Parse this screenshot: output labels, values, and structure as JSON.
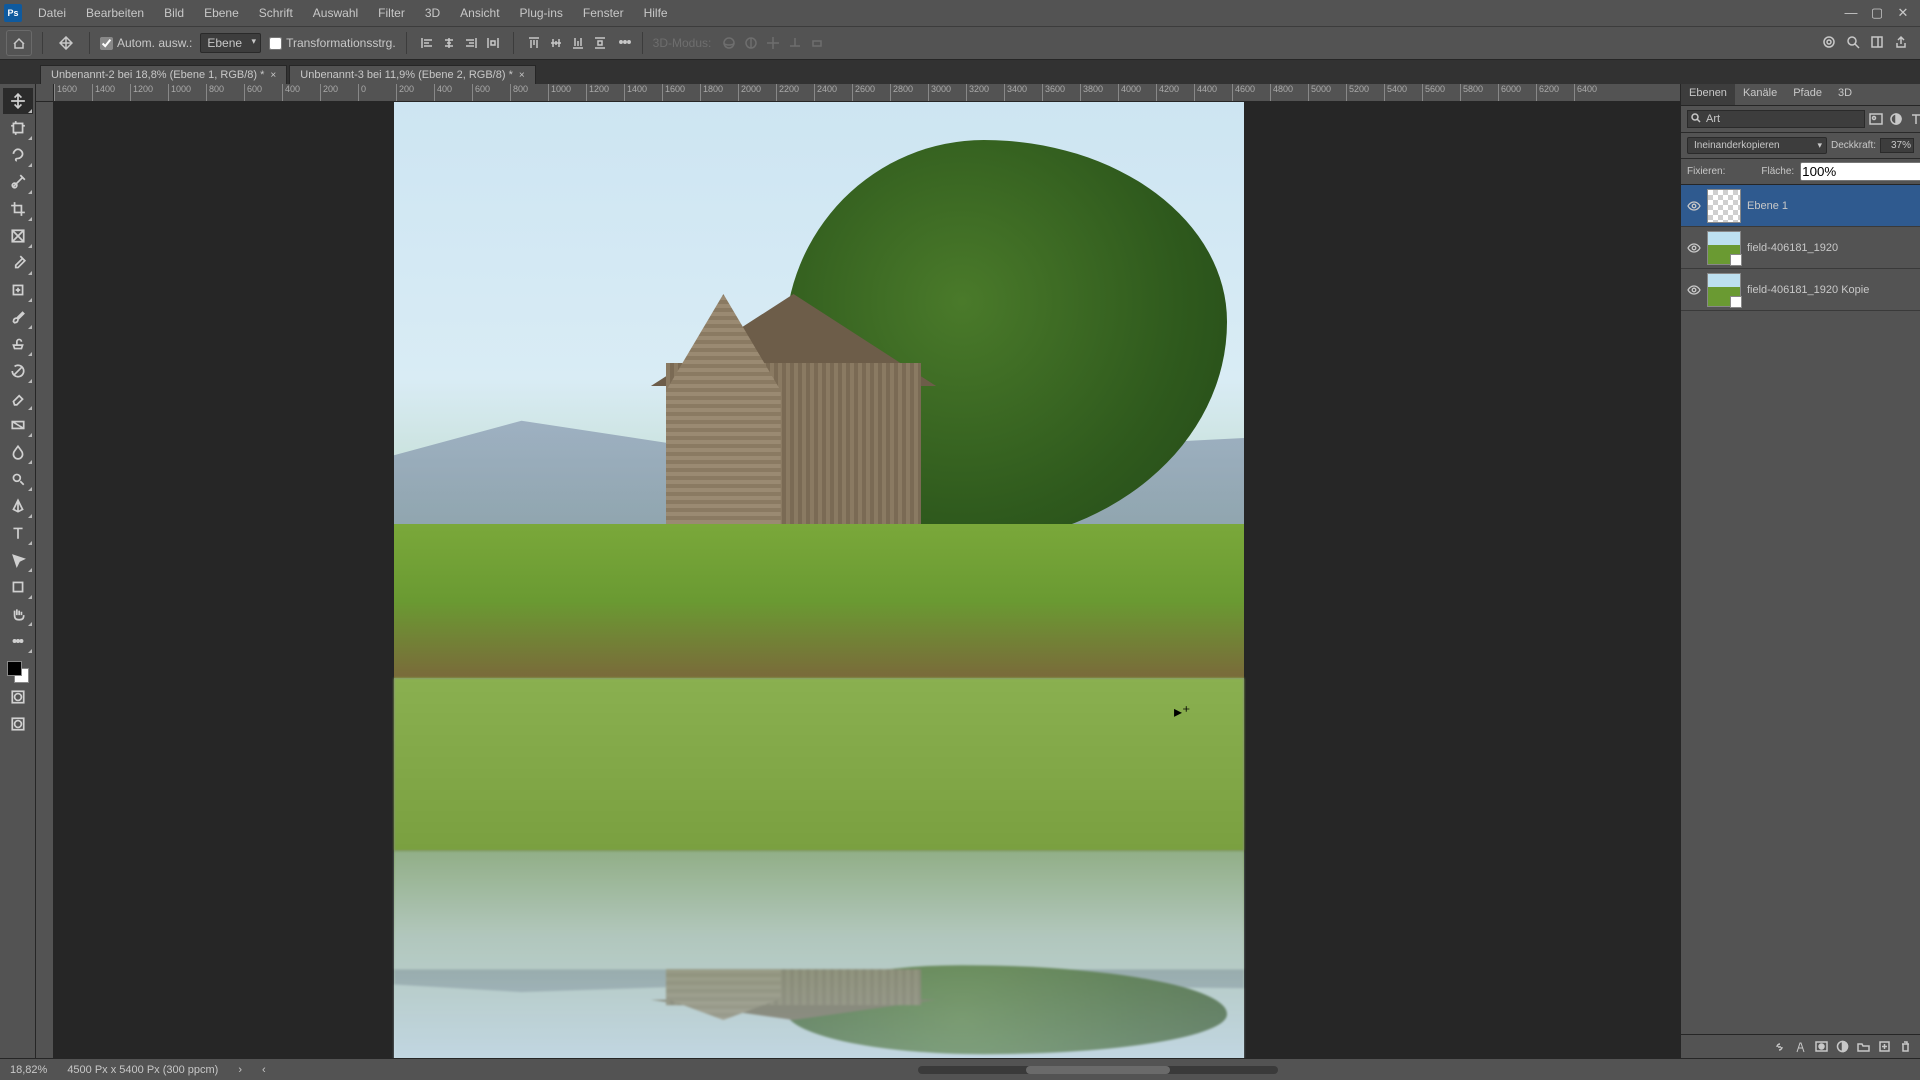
{
  "menu": {
    "items": [
      "Datei",
      "Bearbeiten",
      "Bild",
      "Ebene",
      "Schrift",
      "Auswahl",
      "Filter",
      "3D",
      "Ansicht",
      "Plug-ins",
      "Fenster",
      "Hilfe"
    ]
  },
  "options": {
    "auto_select": "Autom. ausw.:",
    "layer_dd": "Ebene",
    "transform_controls": "Transformationsstrg.",
    "mode3d": "3D-Modus:"
  },
  "tabs": [
    {
      "title": "Unbenannt-2 bei 18,8% (Ebene 1, RGB/8) *"
    },
    {
      "title": "Unbenannt-3 bei 11,9% (Ebene 2, RGB/8) *"
    }
  ],
  "ruler_marks": [
    "1600",
    "1400",
    "1200",
    "1000",
    "800",
    "600",
    "400",
    "200",
    "0",
    "200",
    "400",
    "600",
    "800",
    "1000",
    "1200",
    "1400",
    "1600",
    "1800",
    "2000",
    "2200",
    "2400",
    "2600",
    "2800",
    "3000",
    "3200",
    "3400",
    "3600",
    "3800",
    "4000",
    "4200",
    "4400",
    "4600",
    "4800",
    "5000",
    "5200",
    "5400",
    "5600",
    "5800",
    "6000",
    "6200",
    "6400"
  ],
  "layers_panel": {
    "tabs": [
      "Ebenen",
      "Kanäle",
      "Pfade",
      "3D"
    ],
    "search_placeholder": "Art",
    "blend_mode": "Ineinanderkopieren",
    "opacity_label": "Deckkraft:",
    "opacity_value": "37%",
    "lock_label": "Fixieren:",
    "fill_label": "Fläche:",
    "fill_value": "100%",
    "layers": [
      {
        "name": "Ebene 1",
        "selected": true,
        "thumb": "transparent"
      },
      {
        "name": "field-406181_1920",
        "selected": false,
        "thumb": "img",
        "smart": true
      },
      {
        "name": "field-406181_1920 Kopie",
        "selected": false,
        "thumb": "img",
        "smart": true
      }
    ]
  },
  "status": {
    "zoom": "18,82%",
    "docinfo": "4500 Px x 5400 Px (300 ppcm)"
  }
}
